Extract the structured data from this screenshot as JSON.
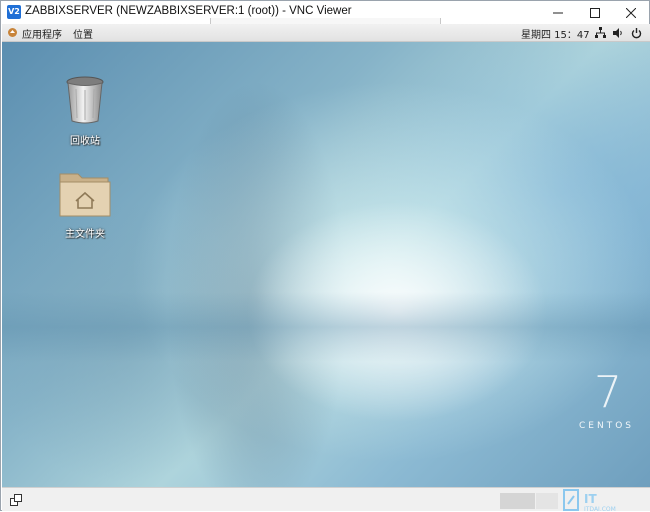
{
  "window": {
    "logo_text": "V2",
    "title": "ZABBIXSERVER (NEWZABBIXSERVER:1 (root)) - VNC Viewer",
    "controls": [
      "minimize-icon",
      "maximize-icon",
      "close-icon"
    ]
  },
  "panel": {
    "apps_menu": "应用程序",
    "places_menu": "位置",
    "clock": "星期四 15：47",
    "tray": [
      "network-icon",
      "volume-icon",
      "power-icon"
    ]
  },
  "desktop": {
    "icons": [
      {
        "label": "回收站",
        "icon": "trash-icon"
      },
      {
        "label": "主文件夹",
        "icon": "home-folder-icon"
      }
    ],
    "branding": {
      "number": "7",
      "word": "CENTOS"
    }
  },
  "colors": {
    "titlebar_bg": "#ffffff",
    "panel_bg": "#e8e8e8",
    "desktop_accent": "#8cbad3",
    "logo": "#1f6fd6"
  }
}
